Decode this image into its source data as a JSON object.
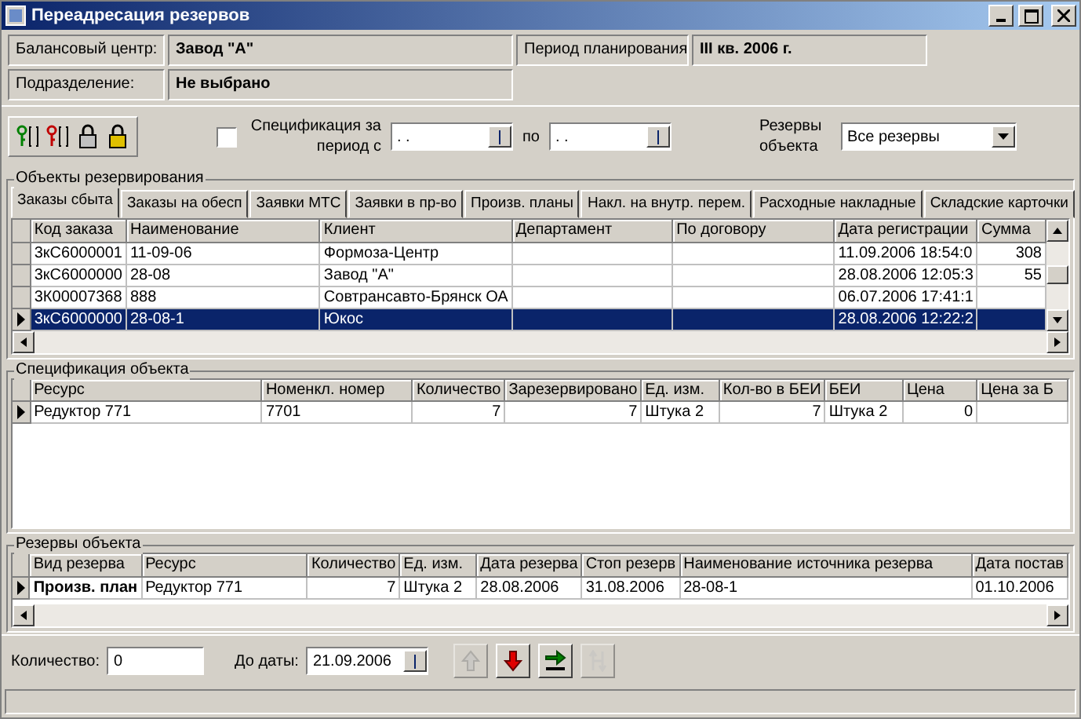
{
  "window": {
    "title": "Переадресация резервов"
  },
  "info": [
    {
      "label": "Балансовый центр:",
      "value": "Завод \"А\""
    },
    {
      "label": "Период планирования",
      "value": "III кв. 2006 г."
    },
    {
      "label": "Подразделение:",
      "value": "Не выбрано"
    }
  ],
  "filter": {
    "spec_label": "Спецификация за период с",
    "checked": false,
    "date_from": ". .",
    "to_label": "по",
    "date_to": ". .",
    "reserves_label": "Резервы объекта",
    "reserves_value": "Все резервы"
  },
  "objects": {
    "title": "Объекты резервирования",
    "tabs": [
      {
        "label": "Заказы сбыта",
        "selected": true
      },
      {
        "label": "Заказы на обесп",
        "selected": false
      },
      {
        "label": "Заявки МТС",
        "selected": false
      },
      {
        "label": "Заявки в пр-во",
        "selected": false
      },
      {
        "label": "Произв. планы",
        "selected": false
      },
      {
        "label": "Накл. на внутр. перем.",
        "selected": false
      },
      {
        "label": "Расходные накладные",
        "selected": false
      },
      {
        "label": "Складские карточки",
        "selected": false
      }
    ],
    "columns": [
      "Код заказа",
      "Наименование",
      "Клиент",
      "Департамент",
      "По договору",
      "Дата регистрации",
      "Сумма"
    ],
    "rows": [
      {
        "current": false,
        "selected": false,
        "cells": [
          "3кС6000001",
          "11-09-06",
          "Формоза-Центр",
          "",
          "",
          "11.09.2006 18:54:0",
          "308"
        ]
      },
      {
        "current": false,
        "selected": false,
        "cells": [
          "3кС6000000",
          "28-08",
          "Завод \"А\"",
          "",
          "",
          "28.08.2006 12:05:3",
          "55"
        ]
      },
      {
        "current": false,
        "selected": false,
        "cells": [
          "3К00007368",
          "888",
          "Совтрансавто-Брянск ОА",
          "",
          "",
          "06.07.2006 17:41:1",
          ""
        ]
      },
      {
        "current": true,
        "selected": true,
        "cells": [
          "3кС6000000",
          "28-08-1",
          "Юкос",
          "",
          "",
          "28.08.2006 12:22:2",
          ""
        ]
      }
    ]
  },
  "specification": {
    "title": "Спецификация объекта",
    "columns": [
      "Ресурс",
      "Номенкл. номер",
      "Количество",
      "Зарезервировано",
      "Ед. изм.",
      "Кол-во в БЕИ",
      "БЕИ",
      "Цена",
      "Цена за Б"
    ],
    "rows": [
      {
        "current": true,
        "selected": false,
        "cells": [
          "Редуктор 771",
          "7701",
          "7",
          "7",
          "Штука 2",
          "7",
          "Штука 2",
          "0",
          ""
        ]
      }
    ]
  },
  "reserves": {
    "title": "Резервы объекта",
    "columns": [
      "Вид резерва",
      "Ресурс",
      "Количество",
      "Ед. изм.",
      "Дата резерва",
      "Стоп резерв",
      "Наименование источника резерва",
      "Дата постав"
    ],
    "rows": [
      {
        "current": true,
        "selected": false,
        "cells": [
          "Произв. план",
          "Редуктор 771",
          "7",
          "Штука 2",
          "28.08.2006",
          "31.08.2006",
          "28-08-1",
          "01.10.2006"
        ]
      }
    ]
  },
  "bottom": {
    "quantity_label": "Количество:",
    "quantity": "0",
    "date_label": "До даты:",
    "date": "21.09.2006",
    "buttons": [
      {
        "kind": "up",
        "disabled": true
      },
      {
        "kind": "down",
        "disabled": false
      },
      {
        "kind": "move",
        "disabled": false
      },
      {
        "kind": "split",
        "disabled": true
      }
    ]
  }
}
